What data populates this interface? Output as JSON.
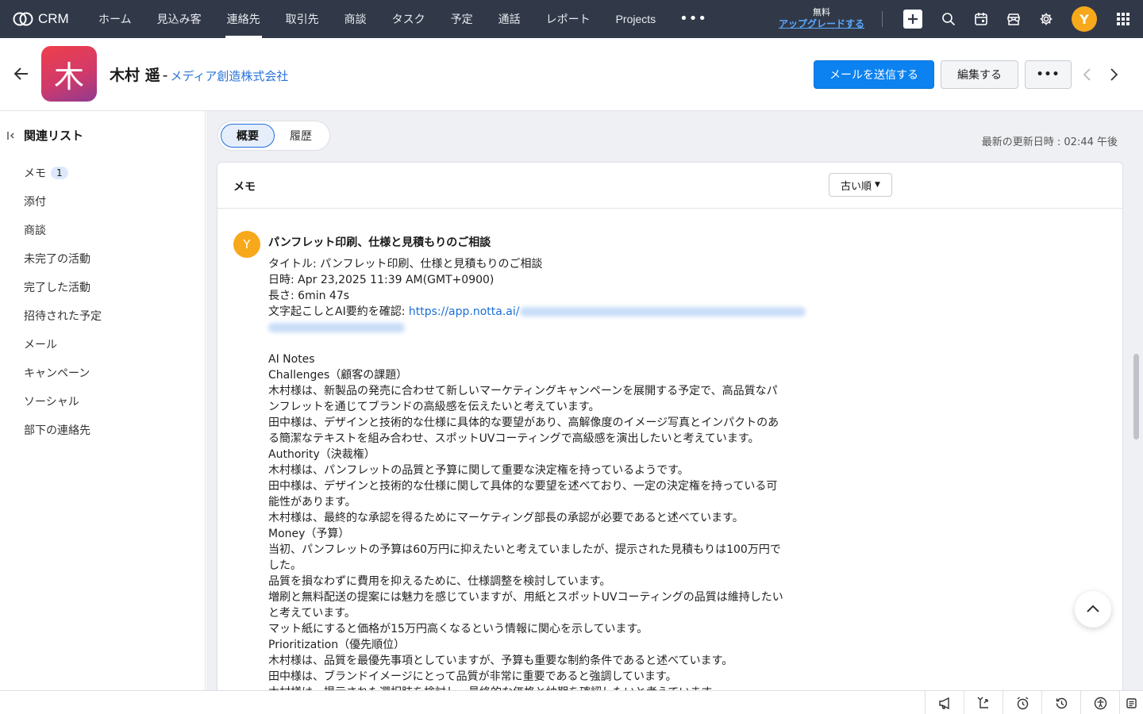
{
  "app": {
    "name": "CRM"
  },
  "nav": {
    "items": [
      {
        "label": "ホーム"
      },
      {
        "label": "見込み客"
      },
      {
        "label": "連絡先",
        "active": true
      },
      {
        "label": "取引先"
      },
      {
        "label": "商談"
      },
      {
        "label": "タスク"
      },
      {
        "label": "予定"
      },
      {
        "label": "通話"
      },
      {
        "label": "レポート"
      },
      {
        "label": "Projects"
      }
    ],
    "more": "•••",
    "upgrade_free": "無料",
    "upgrade_link": "アップグレードする",
    "user_initial": "Y",
    "icons": [
      "plus-icon",
      "search-icon",
      "calendar-icon",
      "marketplace-icon",
      "gear-icon",
      "apps-grid-icon"
    ]
  },
  "record": {
    "avatar_char": "木",
    "name": "木村 遥",
    "separator": "-",
    "company": "メディア創造株式会社",
    "send_email_label": "メールを送信する",
    "edit_label": "編集する",
    "more_label": "•••"
  },
  "sidebar": {
    "title": "関連リスト",
    "items": [
      {
        "label": "メモ",
        "count": "1"
      },
      {
        "label": "添付"
      },
      {
        "label": "商談"
      },
      {
        "label": "未完了の活動"
      },
      {
        "label": "完了した活動"
      },
      {
        "label": "招待された予定"
      },
      {
        "label": "メール"
      },
      {
        "label": "キャンペーン"
      },
      {
        "label": "ソーシャル"
      },
      {
        "label": "部下の連絡先"
      }
    ]
  },
  "main": {
    "tabs": [
      {
        "label": "概要",
        "active": true
      },
      {
        "label": "履歴"
      }
    ],
    "last_updated": "最新の更新日時 : 02:44 午後",
    "notes": {
      "title": "メモ",
      "sort_label": "古い順",
      "note": {
        "author_initial": "Y",
        "title": "パンフレット印刷、仕様と見積もりのご相談",
        "meta_title": "タイトル: パンフレット印刷、仕様と見積もりのご相談",
        "meta_date": "日時: Apr 23,2025 11:39 AM(GMT+0900)",
        "meta_length": "長さ: 6min 47s",
        "meta_link_prefix": "文字起こしとAI要約を確認: ",
        "meta_link": "https://app.notta.ai/",
        "body_lines": [
          "AI Notes",
          "Challenges（顧客の課題）",
          "木村様は、新製品の発売に合わせて新しいマーケティングキャンペーンを展開する予定で、高品質なパ",
          "ンフレットを通じてブランドの高級感を伝えたいと考えています。",
          "田中様は、デザインと技術的な仕様に具体的な要望があり、高解像度のイメージ写真とインパクトのあ",
          "る簡潔なテキストを組み合わせ、スポットUVコーティングで高級感を演出したいと考えています。",
          "Authority（決裁権）",
          "木村様は、パンフレットの品質と予算に関して重要な決定権を持っているようです。",
          "田中様は、デザインと技術的な仕様に関して具体的な要望を述べており、一定の決定権を持っている可",
          "能性があります。",
          "木村様は、最終的な承認を得るためにマーケティング部長の承認が必要であると述べています。",
          "Money（予算）",
          "当初、パンフレットの予算は60万円に抑えたいと考えていましたが、提示された見積もりは100万円で",
          "した。",
          "品質を損なわずに費用を抑えるために、仕様調整を検討しています。",
          "増刷と無料配送の提案には魅力を感じていますが、用紙とスポットUVコーティングの品質は維持したい",
          "と考えています。",
          "マット紙にすると価格が15万円高くなるという情報に関心を示しています。",
          "Prioritization（優先順位）",
          "木村様は、品質を最優先事項としていますが、予算も重要な制約条件であると述べています。",
          "田中様は、ブランドイメージにとって品質が非常に重要であると強調しています。",
          "木村様は、提示された選択肢を検討し、最終的な価格と納期を確認したいと考えています。"
        ]
      }
    }
  },
  "bottombar": {
    "icons": [
      "megaphone-icon",
      "share-icon",
      "alarm-clock-icon",
      "history-icon",
      "accessibility-icon",
      "notes-icon"
    ]
  },
  "colors": {
    "topnav": "#313949",
    "primary": "#0b82f0",
    "link": "#2a73d9",
    "avatar": "#f7a81b"
  }
}
